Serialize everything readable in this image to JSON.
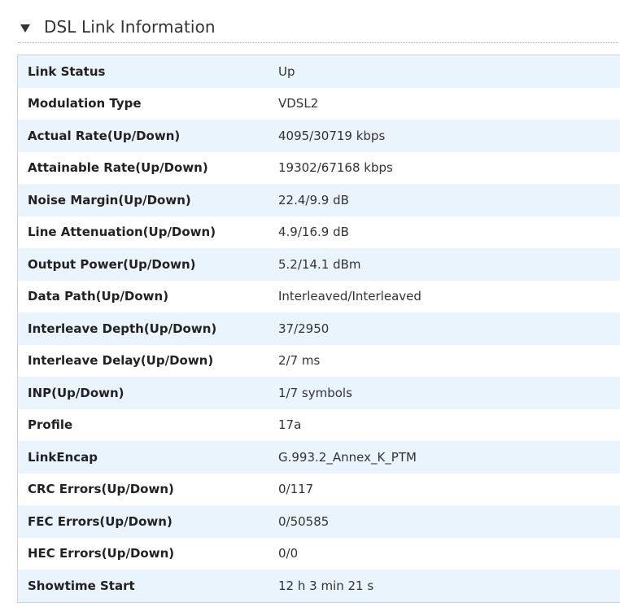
{
  "section": {
    "title": "DSL Link Information"
  },
  "rows": [
    {
      "label": "Link Status",
      "value": "Up"
    },
    {
      "label": "Modulation Type",
      "value": "VDSL2"
    },
    {
      "label": "Actual Rate(Up/Down)",
      "value": "4095/30719 kbps"
    },
    {
      "label": "Attainable Rate(Up/Down)",
      "value": "19302/67168 kbps"
    },
    {
      "label": "Noise Margin(Up/Down)",
      "value": "22.4/9.9 dB"
    },
    {
      "label": "Line Attenuation(Up/Down)",
      "value": "4.9/16.9 dB"
    },
    {
      "label": "Output Power(Up/Down)",
      "value": "5.2/14.1 dBm"
    },
    {
      "label": "Data Path(Up/Down)",
      "value": "Interleaved/Interleaved"
    },
    {
      "label": "Interleave Depth(Up/Down)",
      "value": "37/2950"
    },
    {
      "label": "Interleave Delay(Up/Down)",
      "value": "2/7 ms"
    },
    {
      "label": "INP(Up/Down)",
      "value": "1/7 symbols"
    },
    {
      "label": "Profile",
      "value": "17a"
    },
    {
      "label": "LinkEncap",
      "value": "G.993.2_Annex_K_PTM"
    },
    {
      "label": "CRC Errors(Up/Down)",
      "value": "0/117"
    },
    {
      "label": "FEC Errors(Up/Down)",
      "value": "0/50585"
    },
    {
      "label": "HEC Errors(Up/Down)",
      "value": "0/0"
    },
    {
      "label": "Showtime Start",
      "value": "12 h 3 min 21 s"
    }
  ],
  "colors": {
    "row_stripe": "#eaf4fd",
    "row_plain": "#ffffff",
    "border": "#cfcfcf"
  },
  "icons": {
    "section_toggle": "triangle-down-icon"
  }
}
